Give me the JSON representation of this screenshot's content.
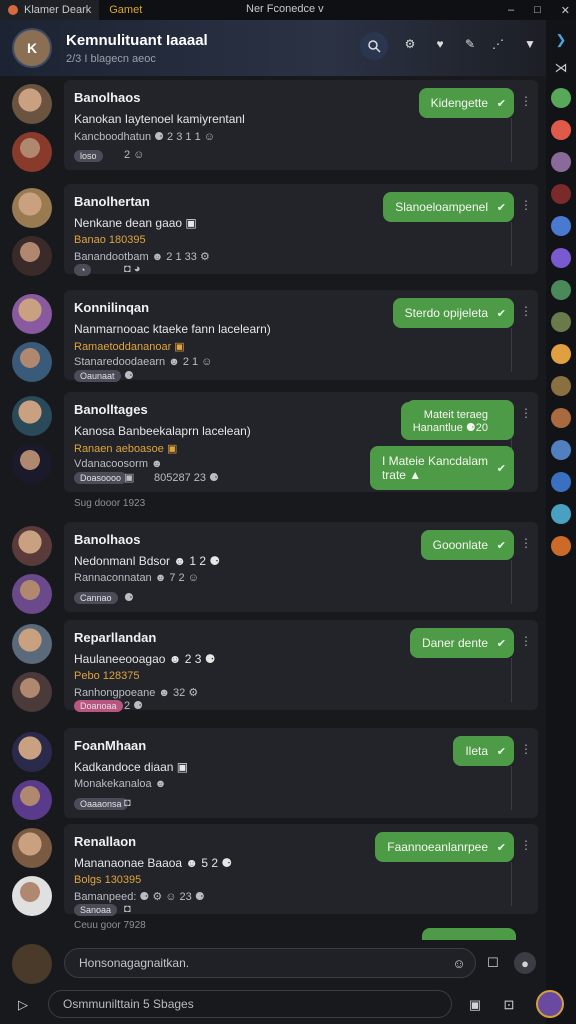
{
  "titlebar": {
    "tab1": "Klamer Deark",
    "tab2": "Gamet",
    "center": "Ner Fconedce",
    "center_arrow": "v",
    "min": "–",
    "max": "□",
    "close": "✕"
  },
  "header": {
    "title": "Kemnulituant Iaaaal",
    "subtitle": "2/3 I blagecn aeoc",
    "avatar": "K"
  },
  "rail": {
    "icons": [
      "#58a85a",
      "#e05a4a",
      "#8a6a9a",
      "#7a2a2a",
      "#4a7ad0",
      "#7a5ad0",
      "#4a8a5a",
      "#6a7a4a",
      "#e0a040",
      "#8a7040",
      "#aa6a40",
      "#5080c0",
      "#3a70c0",
      "#4aa0c0",
      "#cc6a2a"
    ]
  },
  "conversations": [
    {
      "name": "Banolhaos",
      "line1": "Kanokan Iaytenoel kamiyrentanl",
      "line2": "Kancboodhatun ⚈ 2 3  1 1 ☺",
      "badge": "loso",
      "badge2": "2 ☺",
      "bubble": "Kidengette",
      "a1": "#6a5440",
      "a2": "#8a3a2a"
    },
    {
      "name": "Banolhertan",
      "line1": "Nenkane dean gaao ▣",
      "line2": "Banao 180395",
      "line3": "Banandootbam ☻ 2 1 33 ⚙",
      "badge": "◔",
      "badge2": "◘ ◕",
      "bubble": "Slanoeloampenel",
      "a1": "#9a7a50",
      "a2": "#3a2a2a"
    },
    {
      "name": "Konnilinqan",
      "line1": "Nanmarnooac ktaeke fann lacelearn)",
      "line2": "Ramaetoddananoar ▣",
      "line3": "Stanaredoodaearn ☻ 2  1  ☺",
      "badge": "Oaunaat",
      "badge2": "⚈",
      "bubble": "Sterdo opijeleta",
      "a1": "#8a5aa0",
      "a2": "#3a5a7a"
    },
    {
      "name": "Banolltages",
      "line1": "Kanosa Banbeekalaprn lacelean)",
      "line2": "Ranaen aeboasoe ▣",
      "line3": "Vdanacoosorm ☻",
      "badge": "Doasoooo",
      "badge2": "▣",
      "ts": "805287 23 ⚈",
      "bubble": "Mateit teraeg",
      "bubble_sub": "Hanantlue ⚈20",
      "bubble2": "I Mateie Kancdalam",
      "bubble2_sub": "trate ▲",
      "a1": "#2a4a5a",
      "a2": "#1a1a2a"
    },
    {
      "name": "Banolhaos",
      "line1": "Nedonmanl Bdsor ☻ 1 2 ⚈",
      "line2": "Rannaconnatan ☻ 7 2 ☺",
      "badge": "Cannao",
      "badge2": "⚈",
      "bubble": "Gooonlate",
      "a1": "#5a3a3a",
      "a2": "#6a4a8a"
    },
    {
      "name": "Reparllandan",
      "line1": "Haulaneeooagao ☻ 2 3 ⚈",
      "line2": "Pebo 128375",
      "line3": "Ranhongpoeane ☻ 32 ⚙",
      "badge": "Doanoaa",
      "badge2": "2 ⚈",
      "bubble": "Daner dente",
      "a1": "#5a6a7a",
      "a2": "#4a3a3a",
      "pink": true
    },
    {
      "name": "FoanMhaan",
      "line1": "Kadkandoce diaan ▣",
      "line2": "Monakekanaloa ☻",
      "badge": "Oaaaonsa",
      "badge2": "◘",
      "bubble": "Ileta",
      "a1": "#2a2a4a",
      "a2": "#5a3a8a"
    },
    {
      "name": "Renallaon",
      "line1": "Mananaonae Baaoa ☻ 5 2 ⚈",
      "line2": "Bolgs 130395",
      "line3": "Bamanpeed: ⚈ ⚙ ☺ 23 ⚈",
      "badge": "Sanoaa",
      "badge2": "◘",
      "bubble": "Faannoeanlanrpee",
      "a1": "#7a5a40",
      "a2": "#e0e0e0"
    }
  ],
  "date1": "Sug dooor 1923",
  "date2": "Ceuu goor 7928",
  "composer": {
    "placeholder1": "Honsonagagnaitkan.",
    "placeholder2": "Osmmunilttain 5 Sbages",
    "send_icon": "send-icon"
  }
}
